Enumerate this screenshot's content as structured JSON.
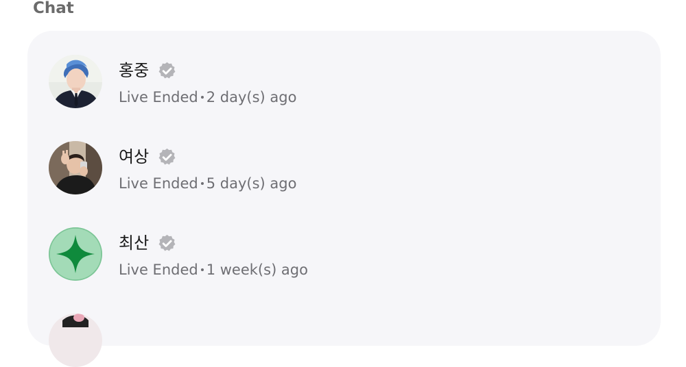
{
  "section": {
    "title": "Chat"
  },
  "chats": [
    {
      "name": "홍중",
      "status": "Live Ended",
      "time": "2 day(s) ago",
      "avatar": "portrait-photo"
    },
    {
      "name": "여상",
      "status": "Live Ended",
      "time": "5 day(s) ago",
      "avatar": "selfie-photo"
    },
    {
      "name": "최산",
      "status": "Live Ended",
      "time": "1 week(s) ago",
      "avatar": "green-sparkle-icon"
    }
  ],
  "colors": {
    "panel_bg": "#f6f6f9",
    "title": "#6b6b6b",
    "secondary_text": "#6e6e73",
    "verified_badge": "#b4b4b8",
    "green_avatar_bg": "#a3dbb7",
    "green_avatar_star": "#0f8a3c"
  }
}
